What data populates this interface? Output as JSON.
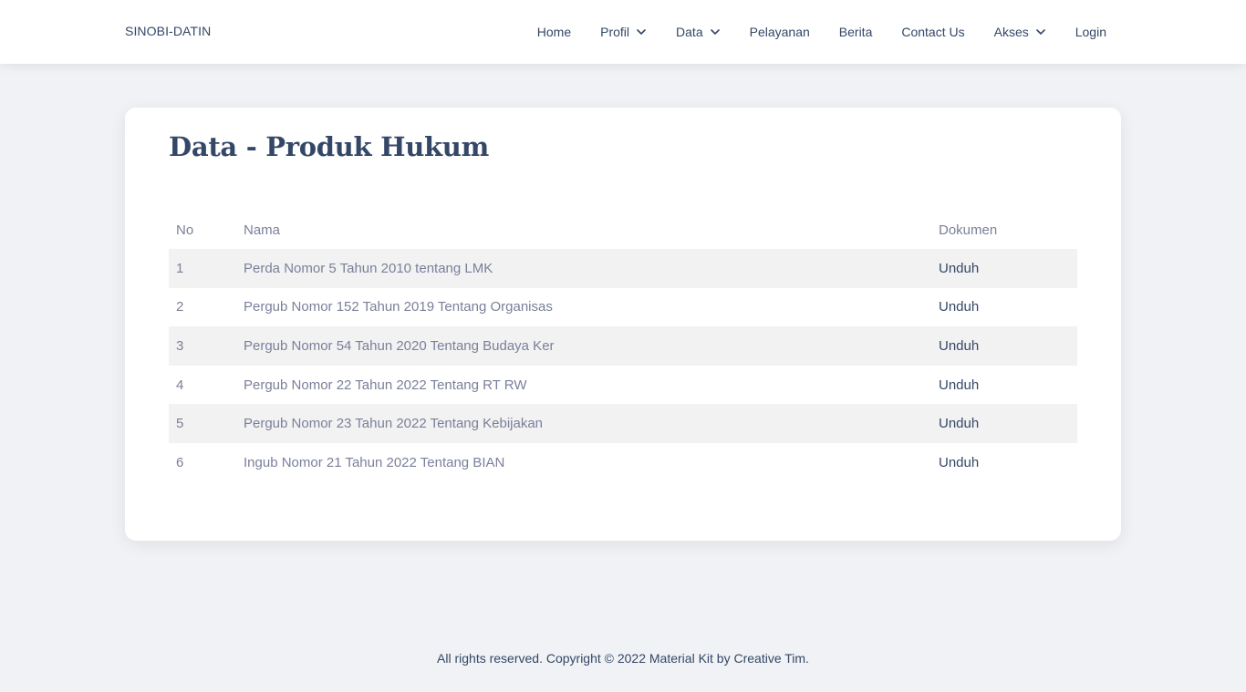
{
  "navbar": {
    "brand": "SINOBI-DATIN",
    "items": [
      {
        "label": "Home",
        "dropdown": false
      },
      {
        "label": "Profil",
        "dropdown": true
      },
      {
        "label": "Data",
        "dropdown": true
      },
      {
        "label": "Pelayanan",
        "dropdown": false
      },
      {
        "label": "Berita",
        "dropdown": false
      },
      {
        "label": "Contact Us",
        "dropdown": false
      },
      {
        "label": "Akses",
        "dropdown": true
      },
      {
        "label": "Login",
        "dropdown": false
      }
    ]
  },
  "main": {
    "title": "Data - Produk Hukum",
    "table": {
      "headers": [
        "No",
        "Nama",
        "Dokumen"
      ],
      "rows": [
        {
          "no": "1",
          "nama": "Perda Nomor 5 Tahun 2010 tentang LMK",
          "dokumen": "Unduh"
        },
        {
          "no": "2",
          "nama": "Pergub Nomor 152 Tahun 2019 Tentang Organisas",
          "dokumen": "Unduh"
        },
        {
          "no": "3",
          "nama": "Pergub Nomor 54 Tahun 2020 Tentang Budaya Ker",
          "dokumen": "Unduh"
        },
        {
          "no": "4",
          "nama": "Pergub Nomor 22 Tahun 2022 Tentang RT RW",
          "dokumen": "Unduh"
        },
        {
          "no": "5",
          "nama": "Pergub Nomor 23 Tahun 2022 Tentang Kebijakan",
          "dokumen": "Unduh"
        },
        {
          "no": "6",
          "nama": "Ingub Nomor 21 Tahun 2022 Tentang BIAN",
          "dokumen": "Unduh"
        }
      ]
    }
  },
  "footer": {
    "text": "All rights reserved. Copyright © 2022 Material Kit by Creative Tim."
  },
  "colors": {
    "background": "#f0f2f5",
    "text_dark": "#344767",
    "text_muted": "#7b809a",
    "row_stripe": "#f2f2f2"
  },
  "icons": {
    "dropdown": "chevron-down-icon"
  }
}
